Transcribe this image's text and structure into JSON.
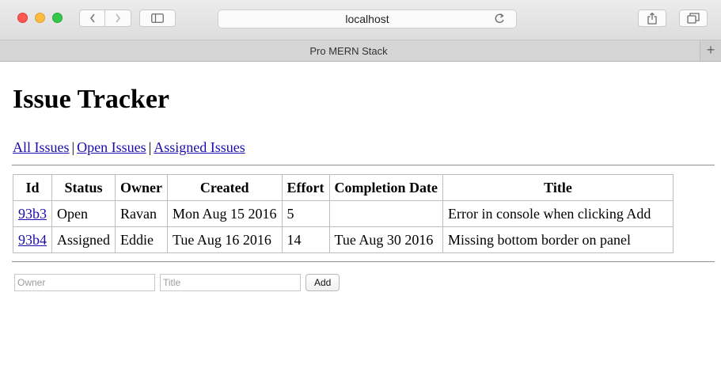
{
  "browser": {
    "address": "localhost",
    "tab_title": "Pro MERN Stack",
    "new_tab_symbol": "+"
  },
  "page": {
    "heading": "Issue Tracker",
    "nav": {
      "all": "All Issues",
      "open": "Open Issues",
      "assigned": "Assigned Issues",
      "separator": "|"
    },
    "table": {
      "headers": [
        "Id",
        "Status",
        "Owner",
        "Created",
        "Effort",
        "Completion Date",
        "Title"
      ],
      "rows": [
        [
          "93b3",
          "Open",
          "Ravan",
          "Mon Aug 15 2016",
          "5",
          "",
          "Error in console when clicking Add"
        ],
        [
          "93b4",
          "Assigned",
          "Eddie",
          "Tue Aug 16 2016",
          "14",
          "Tue Aug 30 2016",
          "Missing bottom border on panel"
        ]
      ]
    },
    "form": {
      "owner_placeholder": "Owner",
      "title_placeholder": "Title",
      "add_label": "Add"
    }
  },
  "icons": {
    "traffic_lights": [
      "close-icon",
      "minimize-icon",
      "zoom-icon"
    ],
    "toolbar": [
      "chevron-left-icon",
      "chevron-right-icon",
      "sidebar-icon",
      "reload-icon",
      "share-icon",
      "tabs-icon"
    ]
  },
  "colors": {
    "link": "#1a0dab",
    "close": "#fc5753",
    "minimize": "#fdbc40",
    "zoom": "#34c84a"
  }
}
